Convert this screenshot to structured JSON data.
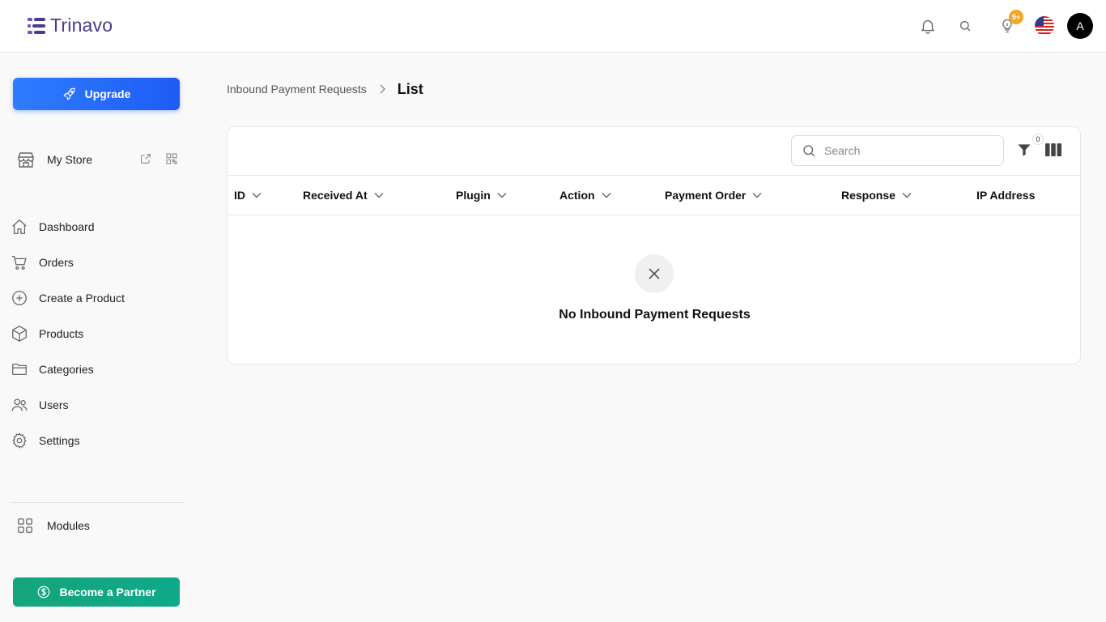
{
  "app": {
    "logo_text": "Trinavo"
  },
  "header": {
    "notification_badge": "9+",
    "avatar_initial": "A"
  },
  "sidebar": {
    "upgrade_label": "Upgrade",
    "store_label": "My Store",
    "items": [
      {
        "label": "Dashboard",
        "icon": "home-icon"
      },
      {
        "label": "Orders",
        "icon": "cart-icon"
      },
      {
        "label": "Create a Product",
        "icon": "plus-circle-icon"
      },
      {
        "label": "Products",
        "icon": "box-icon"
      },
      {
        "label": "Categories",
        "icon": "folder-icon"
      },
      {
        "label": "Users",
        "icon": "users-icon"
      },
      {
        "label": "Settings",
        "icon": "gear-icon"
      }
    ],
    "modules_label": "Modules",
    "partner_label": "Become a Partner"
  },
  "breadcrumb": {
    "parent": "Inbound Payment Requests",
    "current": "List"
  },
  "table": {
    "search_placeholder": "Search",
    "filter_count": "0",
    "columns": [
      "ID",
      "Received At",
      "Plugin",
      "Action",
      "Payment Order",
      "Response",
      "IP Address"
    ],
    "empty_message": "No Inbound Payment Requests"
  },
  "colors": {
    "brand": "#4a3a8f",
    "upgrade": "#1e5cf5",
    "partner": "#15a57a",
    "badge": "#f5a623"
  }
}
